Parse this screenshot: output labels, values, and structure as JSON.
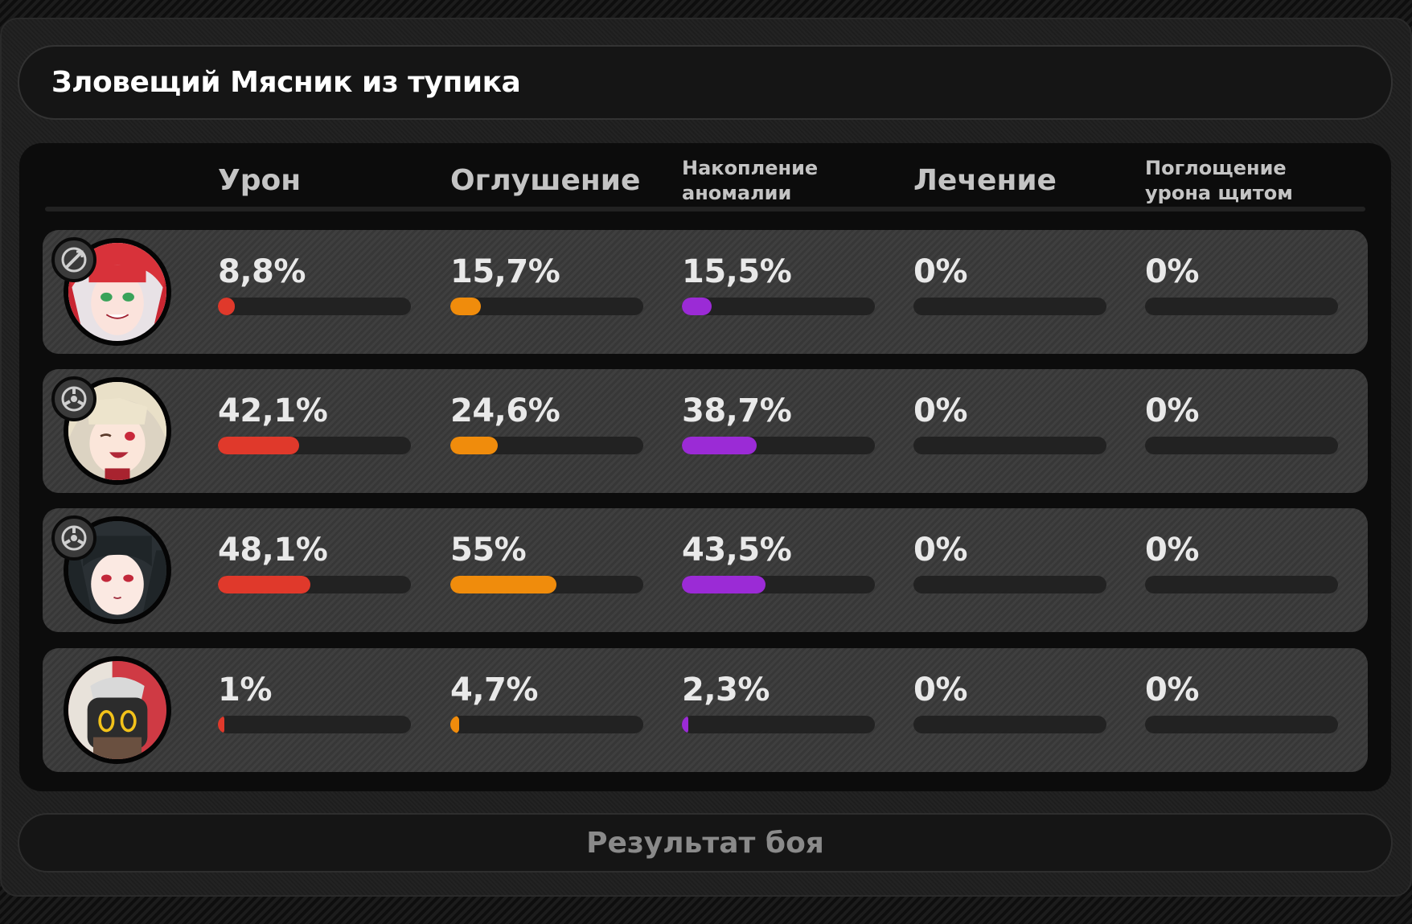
{
  "title": "Зловещий Мясник из тупика",
  "columns": {
    "damage": "Урон",
    "daze": "Оглушение",
    "anomaly_line1": "Накопление",
    "anomaly_line2": "аномалии",
    "healing": "Лечение",
    "shield_line1": "Поглощение",
    "shield_line2": "урона щитом"
  },
  "colors": {
    "damage": "#e0392b",
    "daze": "#f08c0c",
    "anomaly": "#9b2bd6",
    "healing": "#3aa35a",
    "shield": "#3a8fd6"
  },
  "rows": [
    {
      "avatar_icon": "red-haired-agent-portrait",
      "badge_icon": "attack-type-icon",
      "damage": "8,8%",
      "damage_fill": 0.088,
      "daze": "15,7%",
      "daze_fill": 0.157,
      "anomaly": "15,5%",
      "anomaly_fill": 0.155,
      "healing": "0%",
      "healing_fill": 0,
      "shield": "0%",
      "shield_fill": 0
    },
    {
      "avatar_icon": "blonde-agent-portrait",
      "badge_icon": "anomaly-type-icon",
      "damage": "42,1%",
      "damage_fill": 0.421,
      "daze": "24,6%",
      "daze_fill": 0.246,
      "anomaly": "38,7%",
      "anomaly_fill": 0.387,
      "healing": "0%",
      "healing_fill": 0,
      "shield": "0%",
      "shield_fill": 0
    },
    {
      "avatar_icon": "dark-haired-agent-portrait",
      "badge_icon": "anomaly-type-icon",
      "damage": "48,1%",
      "damage_fill": 0.481,
      "daze": "55%",
      "daze_fill": 0.55,
      "anomaly": "43,5%",
      "anomaly_fill": 0.435,
      "healing": "0%",
      "healing_fill": 0,
      "shield": "0%",
      "shield_fill": 0
    },
    {
      "avatar_icon": "bangboo-portrait",
      "badge_icon": "",
      "damage": "1%",
      "damage_fill": 0.01,
      "daze": "4,7%",
      "daze_fill": 0.047,
      "anomaly": "2,3%",
      "anomaly_fill": 0.023,
      "healing": "0%",
      "healing_fill": 0,
      "shield": "0%",
      "shield_fill": 0
    }
  ],
  "footer": {
    "button_label": "Результат боя"
  }
}
